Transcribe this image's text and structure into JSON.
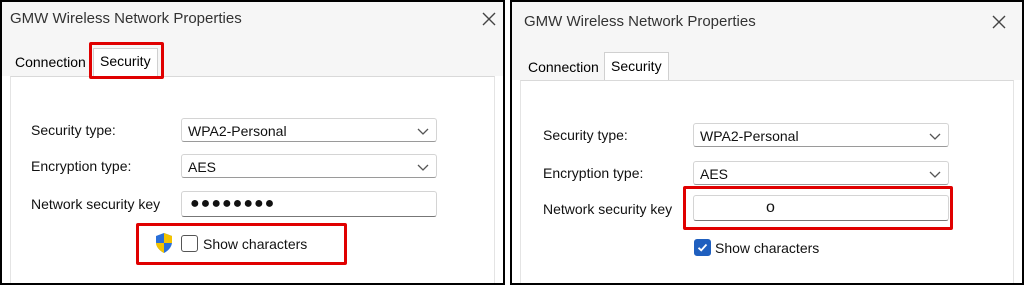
{
  "left": {
    "title": "GMW Wireless Network Properties",
    "tabs": [
      {
        "label": "Connection",
        "active": false
      },
      {
        "label": "Security",
        "active": true
      }
    ],
    "fields": {
      "security_type_label": "Security type:",
      "security_type_value": "WPA2-Personal",
      "encryption_type_label": "Encryption type:",
      "encryption_type_value": "AES",
      "network_key_label": "Network security key",
      "network_key_value": "●●●●●●●●"
    },
    "show_characters": {
      "label": "Show characters",
      "checked": false
    },
    "icons": {
      "close": "close-icon",
      "shield": "uac-shield-icon",
      "dropdown": "chevron-down-icon"
    }
  },
  "right": {
    "title": "GMW Wireless Network Properties",
    "tabs": [
      {
        "label": "Connection",
        "active": false
      },
      {
        "label": "Security",
        "active": true
      }
    ],
    "fields": {
      "security_type_label": "Security type:",
      "security_type_value": "WPA2-Personal",
      "encryption_type_label": "Encryption type:",
      "encryption_type_value": "AES",
      "network_key_label": "Network security key",
      "network_key_value": "o"
    },
    "show_characters": {
      "label": "Show characters",
      "checked": true
    },
    "icons": {
      "close": "close-icon",
      "dropdown": "chevron-down-icon",
      "check": "checkmark-icon"
    }
  },
  "colors": {
    "highlight": "#e00000",
    "checkbox_checked": "#1f5fbf",
    "titlebar_bg": "#f6f6f6"
  }
}
